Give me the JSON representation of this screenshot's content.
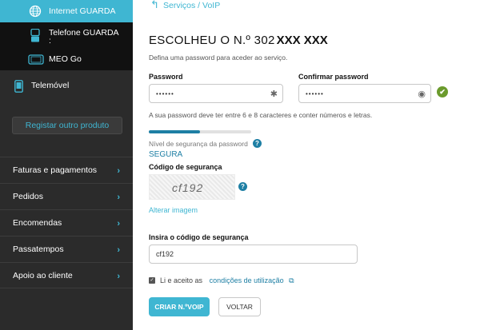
{
  "sidebar": {
    "services": [
      {
        "label": "Internet GUARDA",
        "icon": "globe-icon"
      },
      {
        "label": "Telefone GUARDA",
        "label_extra": ":",
        "icon": "phone-icon"
      },
      {
        "label": "MEO Go",
        "icon": "tablet-icon"
      }
    ],
    "mobile": {
      "label": "Telemóvel",
      "icon": "mobile-icon"
    },
    "register_button": "Registar outro produto",
    "menu": [
      {
        "label": "Faturas e pagamentos"
      },
      {
        "label": "Pedidos"
      },
      {
        "label": "Encomendas"
      },
      {
        "label": "Passatempos"
      },
      {
        "label": "Apoio ao cliente"
      }
    ],
    "chevron": "›"
  },
  "main": {
    "breadcrumb": {
      "arrow": "↰",
      "text": "Serviços / VoIP"
    },
    "title_prefix": "ESCOLHEU O N.º 302",
    "title_masked": "XXX XXX",
    "subtitle": "Defina uma password para aceder ao serviço.",
    "password": {
      "label": "Password",
      "value": "••••••",
      "trail_icon": "asterisk-icon",
      "trail": "✱"
    },
    "confirm": {
      "label": "Confirmar password",
      "value": "••••••",
      "trail_icon": "eye-icon",
      "trail": "◉"
    },
    "valid_icon": "✔",
    "hint": "A sua password deve ter entre 6 e 8 caracteres e conter números e letras.",
    "strength": {
      "label": "Nível de segurança da password",
      "level": "SEGURA",
      "fill_percent": 50
    },
    "qmark": "?",
    "security_code_label": "Código de segurança",
    "captcha_text": "cf192",
    "change_image": "Alterar imagem",
    "enter_code_label": "Insira o código de segurança",
    "enter_code_value": "cf192",
    "terms_prefix": "Li e aceito as",
    "terms_link": "condições de utilização",
    "terms_ext_icon": "⧉",
    "terms_checked": true,
    "btn_create": "CRIAR N.ºVOIP",
    "btn_back": "VOLTAR"
  },
  "colors": {
    "accent": "#3fb6d2",
    "sidebar": "#2b2b2b",
    "link": "#1e7fa4",
    "ok": "#6b9b2d"
  }
}
